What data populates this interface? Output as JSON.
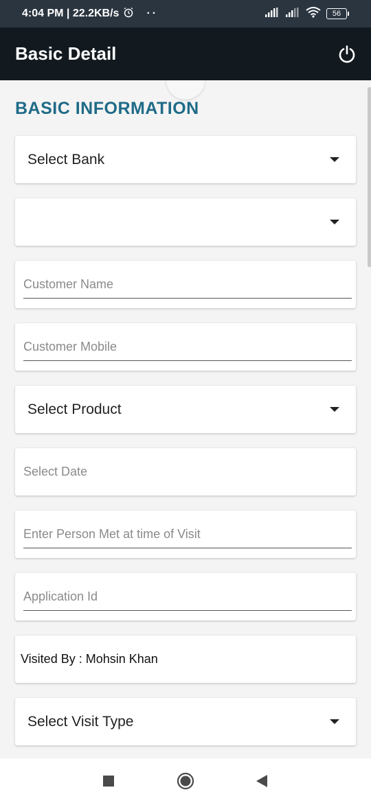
{
  "status_bar": {
    "time_speed": "4:04 PM | 22.2KB/s",
    "dots": "··",
    "battery": "56"
  },
  "app_bar": {
    "title": "Basic Detail",
    "power_icon": "power-icon"
  },
  "section": {
    "title": "BASIC INFORMATION"
  },
  "form": {
    "select_bank": "Select Bank",
    "second_select": "",
    "customer_name_placeholder": "Customer Name",
    "customer_mobile_placeholder": "Customer Mobile",
    "select_product": "Select Product",
    "select_date": "Select Date",
    "person_met_placeholder": "Enter Person Met at time of Visit",
    "application_id_placeholder": "Application Id",
    "visited_by": "Visited By : Mohsin Khan",
    "select_visit_type": "Select Visit Type"
  },
  "nav": {
    "recents_icon": "square-icon",
    "home_icon": "circle-icon",
    "back_icon": "triangle-back-icon"
  },
  "colors": {
    "status_bar": "#2a3540",
    "app_bar": "#121a20",
    "section_title": "#1f6b87",
    "background": "#f4f4f4"
  }
}
